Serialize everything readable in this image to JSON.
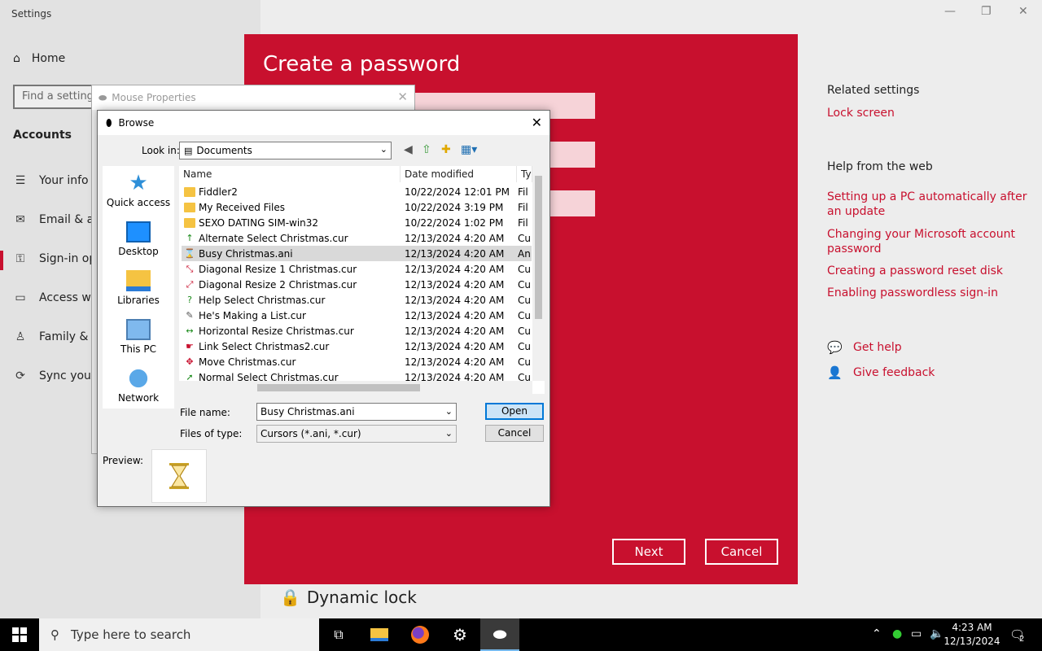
{
  "settings": {
    "window_title": "Settings",
    "home_label": "Home",
    "search_placeholder": "Find a setting",
    "section_label": "Accounts",
    "nav": [
      {
        "label": "Your info",
        "icon": "person-card-icon"
      },
      {
        "label": "Email & ac",
        "icon": "mail-icon"
      },
      {
        "label": "Sign-in op",
        "icon": "key-icon"
      },
      {
        "label": "Access wo",
        "icon": "briefcase-icon"
      },
      {
        "label": "Family & o",
        "icon": "people-icon"
      },
      {
        "label": "Sync your",
        "icon": "sync-icon"
      }
    ],
    "related_title": "Related settings",
    "related_link": "Lock screen",
    "help_web_title": "Help from the web",
    "help_links": [
      "Setting up a PC automatically after an update",
      "Changing your Microsoft account password",
      "Creating a password reset disk",
      "Enabling passwordless sign-in"
    ],
    "get_help": "Get help",
    "give_feedback": "Give feedback",
    "dynamic_lock": "Dynamic lock"
  },
  "create_password": {
    "title": "Create a password",
    "next_label": "Next",
    "cancel_label": "Cancel",
    "accent_color": "#c8102e"
  },
  "mouse_properties": {
    "title": "Mouse Properties"
  },
  "browse": {
    "title": "Browse",
    "look_in_label": "Look in:",
    "look_in_value": "Documents",
    "places": [
      "Quick access",
      "Desktop",
      "Libraries",
      "This PC",
      "Network"
    ],
    "columns": {
      "name": "Name",
      "date": "Date modified",
      "type": "Ty"
    },
    "files": [
      {
        "name": "Fiddler2",
        "date": "10/22/2024 12:01 PM",
        "type": "Fil",
        "icon": "folder"
      },
      {
        "name": "My Received Files",
        "date": "10/22/2024 3:19 PM",
        "type": "Fil",
        "icon": "folder"
      },
      {
        "name": "SEXO DATING SIM-win32",
        "date": "10/22/2024 1:02 PM",
        "type": "Fil",
        "icon": "folder"
      },
      {
        "name": "Alternate Select Christmas.cur",
        "date": "12/13/2024 4:20 AM",
        "type": "Cu",
        "icon": "arrow-up"
      },
      {
        "name": "Busy Christmas.ani",
        "date": "12/13/2024 4:20 AM",
        "type": "An",
        "icon": "hourglass"
      },
      {
        "name": "Diagonal Resize 1 Christmas.cur",
        "date": "12/13/2024 4:20 AM",
        "type": "Cu",
        "icon": "diag1"
      },
      {
        "name": "Diagonal Resize 2 Christmas.cur",
        "date": "12/13/2024 4:20 AM",
        "type": "Cu",
        "icon": "diag2"
      },
      {
        "name": "Help Select Christmas.cur",
        "date": "12/13/2024 4:20 AM",
        "type": "Cu",
        "icon": "help"
      },
      {
        "name": "He's Making a List.cur",
        "date": "12/13/2024 4:20 AM",
        "type": "Cu",
        "icon": "list"
      },
      {
        "name": "Horizontal Resize Christmas.cur",
        "date": "12/13/2024 4:20 AM",
        "type": "Cu",
        "icon": "horiz"
      },
      {
        "name": "Link Select Christmas2.cur",
        "date": "12/13/2024 4:20 AM",
        "type": "Cu",
        "icon": "hand"
      },
      {
        "name": "Move Christmas.cur",
        "date": "12/13/2024 4:20 AM",
        "type": "Cu",
        "icon": "move"
      },
      {
        "name": "Normal Select Christmas.cur",
        "date": "12/13/2024 4:20 AM",
        "type": "Cu",
        "icon": "arrow"
      }
    ],
    "selected_file": "Busy Christmas.ani",
    "file_name_label": "File name:",
    "file_name_value": "Busy Christmas.ani",
    "file_type_label": "Files of type:",
    "file_type_value": "Cursors (*.ani, *.cur)",
    "open_label": "Open",
    "cancel_label": "Cancel",
    "preview_label": "Preview:"
  },
  "taskbar": {
    "search_placeholder": "Type here to search",
    "time": "4:23 AM",
    "date": "12/13/2024",
    "notification_count": "2"
  }
}
